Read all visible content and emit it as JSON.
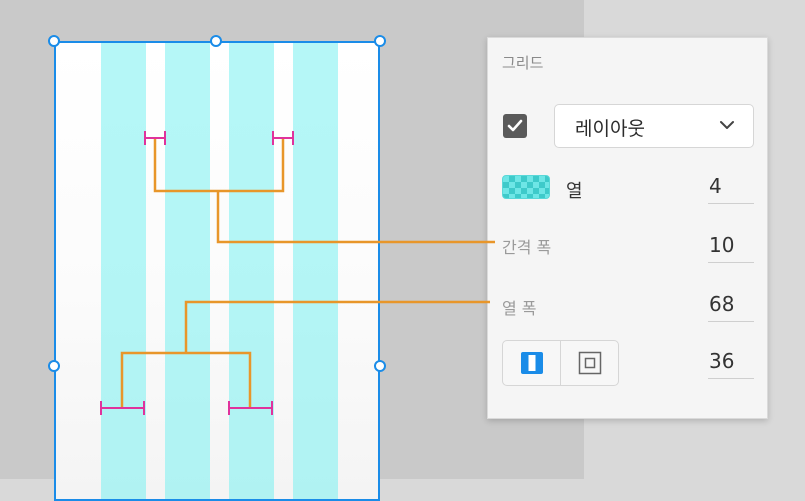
{
  "panel": {
    "title": "그리드",
    "layout_checked": true,
    "dropdown_value": "레이아웃",
    "column_label": "열",
    "column_count": "4",
    "gutter_label": "간격 폭",
    "gutter_value": "10",
    "column_width_label": "열 폭",
    "column_width_value": "68",
    "margin_value": "36"
  },
  "icons": {
    "checkbox": "checkmark-icon",
    "dropdown": "chevron-down-icon",
    "swatch": "grid-color-swatch",
    "linked_margins": "linked-margins-icon",
    "separate_margins": "separate-margins-icon"
  },
  "colors": {
    "selection": "#1a8ce8",
    "column_fill": "#78f0f0",
    "annotation": "#e8962a",
    "measure": "#e0329c",
    "active_toggle": "#1a8ce8"
  }
}
